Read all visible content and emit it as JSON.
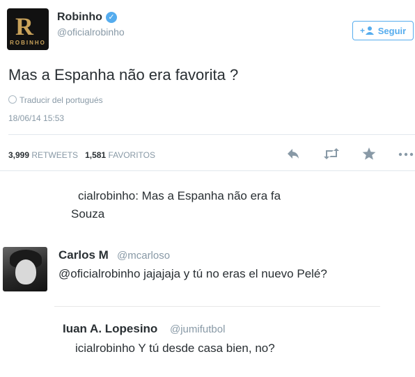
{
  "tweet": {
    "avatar": {
      "monogram": "R",
      "brand": "ROBINHO"
    },
    "name": "Robinho",
    "verified_glyph": "✓",
    "handle": "@oficialrobinho",
    "follow_button": {
      "icon": "add-user-icon",
      "label": "Seguir"
    },
    "text": "Mas a Espanha não era favorita ?",
    "translate": "Traducir del portugués",
    "timestamp": "18/06/14 15:53",
    "stats": {
      "retweets_count": "3,999",
      "retweets_label": "RETWEETS",
      "favorites_count": "1,581",
      "favorites_label": "FAVORITOS"
    },
    "actions": {
      "reply_icon": "reply-icon",
      "retweet_icon": "retweet-icon",
      "favorite_icon": "star-icon",
      "more_icon": "more-icon"
    }
  },
  "replies": {
    "fragment_line1": "cialrobinho: Mas a Espanha não era fa",
    "fragment_line2": "Souza",
    "reply1": {
      "name": "Carlos M",
      "handle": "@mcarloso",
      "text": "@oficialrobinho jajajaja y tú no eras el nuevo Pelé?"
    },
    "reply2": {
      "name": "Iuan A. Lopesino",
      "handle": "@jumifutbol",
      "text": "icialrobinho Y tú desde casa bien, no?"
    }
  },
  "colors": {
    "accent": "#55acee",
    "muted": "#8899a6",
    "text": "#292f33"
  }
}
